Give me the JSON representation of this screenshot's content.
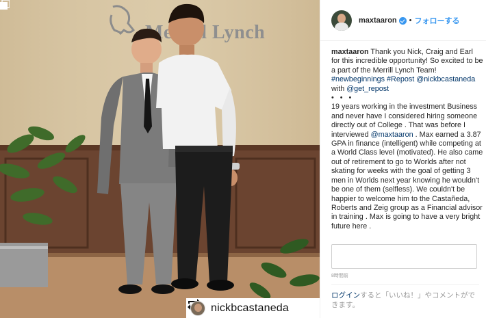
{
  "post": {
    "photo_sign_text": "Merrill Lynch",
    "repost_author": "nickbcastaneda",
    "icons": {
      "carousel": "carousel-icon",
      "repost": "repost-icon",
      "verified": "verified-badge-icon"
    }
  },
  "header": {
    "username": "maxtaaron",
    "separator": "•",
    "follow_label": "フォローする"
  },
  "caption": {
    "username": "maxtaaron",
    "intro": "Thank you Nick, Craig and Earl for this incredible opportunity! So excited to be a part of the Merrill Lynch Team!",
    "tag1": "#newbeginnings",
    "tag2": "#Repost",
    "mention1": "@nickbcastaneda",
    "with_text": "with",
    "mention2": "@get_repost",
    "bullets": "• • •",
    "body_part1": "19 years working in the investment Business and never have I considered hiring someone directly out of College . That was before I interviewed",
    "body_mention": "@maxtaaron",
    "body_part2": ". Max earned a 3.87 GPA in finance (intelligent) while competing at a World Class level (motivated). He also came out of retirement to go to Worlds after not skating for weeks with the goal of getting 3 men in Worlds next year knowing he wouldn't be one of them (selfless). We couldn't be happier to welcome him to the Castañeda, Roberts and Zeig group as a Financial advisor in training . Max is going to have a very bright future here ."
  },
  "meta": {
    "time_ago": "8時間前"
  },
  "footer": {
    "login_link": "ログイン",
    "login_rest": "すると「いいね！」やコメントができます。"
  }
}
